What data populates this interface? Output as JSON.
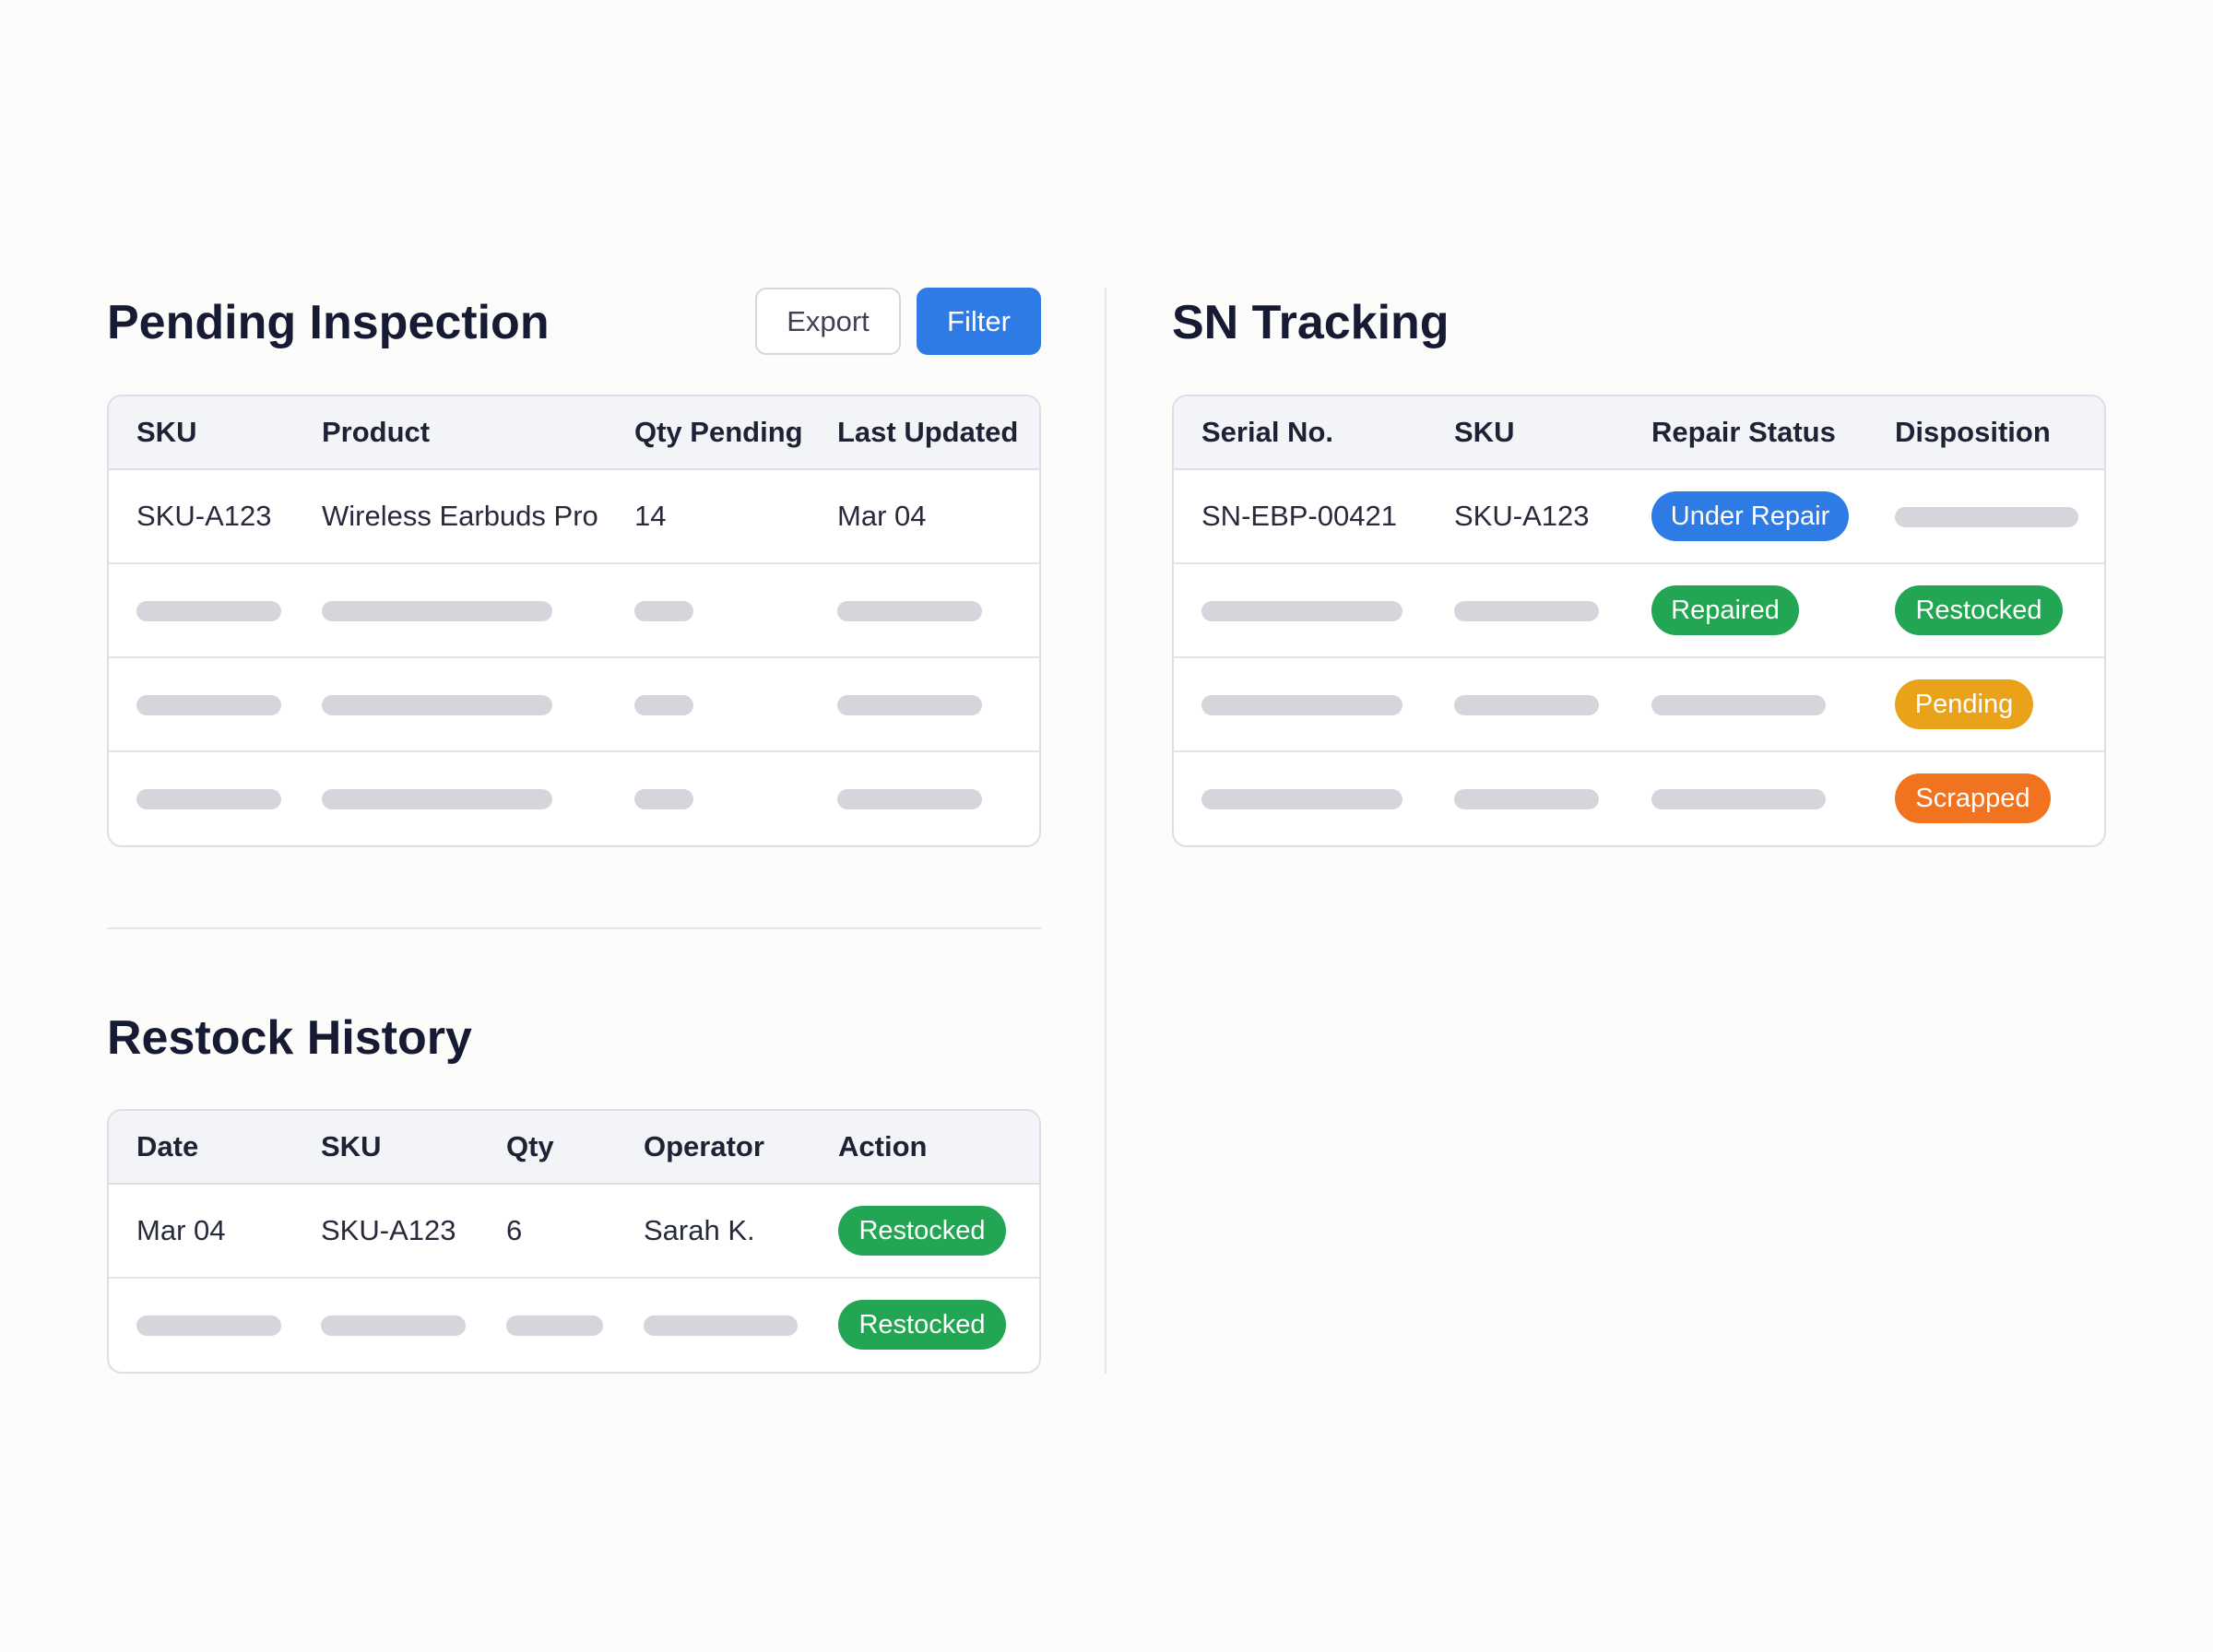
{
  "colors": {
    "primary": "#2f7be6",
    "success": "#22a653",
    "warning": "#e9a21a",
    "danger": "#f2731f",
    "skeleton": "#d4d6dc"
  },
  "pending_inspection": {
    "title": "Pending Inspection",
    "export_label": "Export",
    "filter_label": "Filter",
    "columns": [
      "SKU",
      "Product",
      "Qty Pending",
      "Last Updated"
    ],
    "rows": [
      [
        "SKU-A123",
        "Wireless Earbuds Pro",
        "14",
        "Mar 04"
      ]
    ]
  },
  "restock_history": {
    "title": "Restock History",
    "columns": [
      "Date",
      "SKU",
      "Qty",
      "Operator",
      "Action"
    ],
    "rows": [
      [
        "Mar 04",
        "SKU-A123",
        "6",
        "Sarah K."
      ]
    ],
    "actions": [
      "Restocked",
      "Restocked"
    ]
  },
  "sn_tracking": {
    "title": "SN Tracking",
    "columns": [
      "Serial No.",
      "SKU",
      "Repair Status",
      "Disposition"
    ],
    "rows": [
      [
        "SN-EBP-00421",
        "SKU-A123"
      ]
    ],
    "repair_statuses": [
      "Under Repair",
      "Repaired"
    ],
    "dispositions": [
      "Restocked",
      "Pending",
      "Scrapped"
    ]
  }
}
